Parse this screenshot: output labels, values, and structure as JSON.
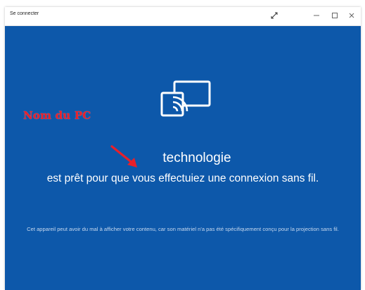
{
  "window": {
    "title": "Se connecter",
    "controls": {
      "expand_icon": "expand-icon",
      "minimize_icon": "minimize-icon",
      "maximize_icon": "maximize-icon",
      "close_icon": "close-icon"
    }
  },
  "main": {
    "icon": "wireless-display-icon",
    "annotation": "Nom du PC",
    "device_name": "technologie",
    "ready_text": "est prêt pour que vous effectuiez une connexion sans fil.",
    "warning_text": "Cet appareil peut avoir du mal à afficher votre contenu, car son matériel n'a pas été spécifiquement conçu pour la projection sans fil."
  },
  "colors": {
    "background": "#0d58aa",
    "text": "#ffffff",
    "annotation": "#e8202a"
  }
}
